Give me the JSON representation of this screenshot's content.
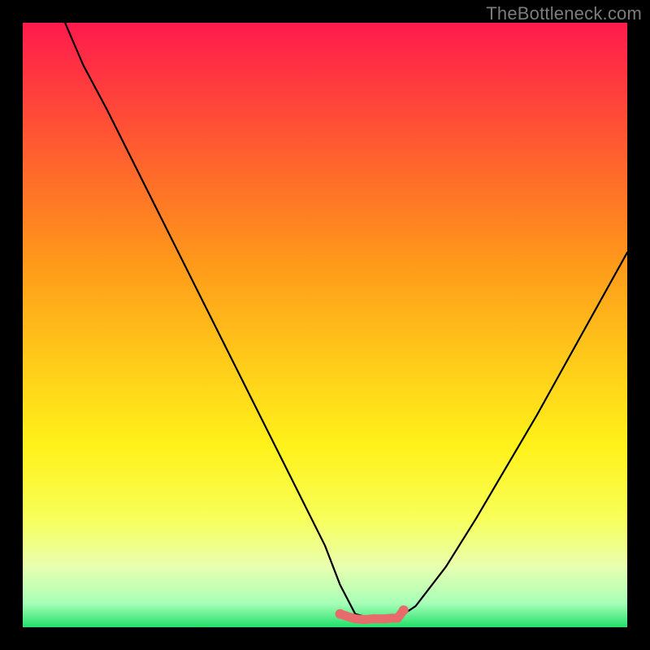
{
  "watermark": {
    "text": "TheBottleneck.com"
  },
  "gradient": {
    "stops": [
      {
        "offset": "0%",
        "color": "#ff1a4d"
      },
      {
        "offset": "10%",
        "color": "#ff3a3f"
      },
      {
        "offset": "25%",
        "color": "#ff6a2a"
      },
      {
        "offset": "40%",
        "color": "#ff9a1a"
      },
      {
        "offset": "55%",
        "color": "#ffc81a"
      },
      {
        "offset": "70%",
        "color": "#fff21a"
      },
      {
        "offset": "82%",
        "color": "#f8ff5a"
      },
      {
        "offset": "90%",
        "color": "#e8ffb0"
      },
      {
        "offset": "96%",
        "color": "#a8ffb8"
      },
      {
        "offset": "100%",
        "color": "#22e06a"
      }
    ]
  },
  "chart_data": {
    "type": "line",
    "title": "",
    "xlabel": "",
    "ylabel": "",
    "xlim": [
      0,
      100
    ],
    "ylim": [
      0,
      100
    ],
    "series": [
      {
        "name": "bottleneck-curve",
        "x": [
          7,
          10,
          14,
          18,
          22,
          26,
          30,
          34,
          38,
          42,
          46,
          50,
          52.5,
          55,
          58,
          60,
          62,
          65,
          70,
          75,
          80,
          85,
          90,
          95,
          100
        ],
        "y": [
          100,
          93,
          85.5,
          77.5,
          69.5,
          61.5,
          53.5,
          45.5,
          37.5,
          29.5,
          21.5,
          13.5,
          7,
          2.2,
          1.4,
          1.4,
          1.5,
          3.5,
          10,
          18,
          26.5,
          35,
          44,
          53,
          62
        ]
      }
    ],
    "highlight": {
      "name": "valley-band",
      "color": "#e76b6b",
      "x": [
        52.5,
        54,
        55,
        56,
        57,
        58,
        59,
        60,
        61,
        62,
        63
      ],
      "y": [
        2.2,
        1.7,
        1.4,
        1.3,
        1.3,
        1.4,
        1.4,
        1.4,
        1.5,
        1.5,
        2.8
      ]
    }
  }
}
